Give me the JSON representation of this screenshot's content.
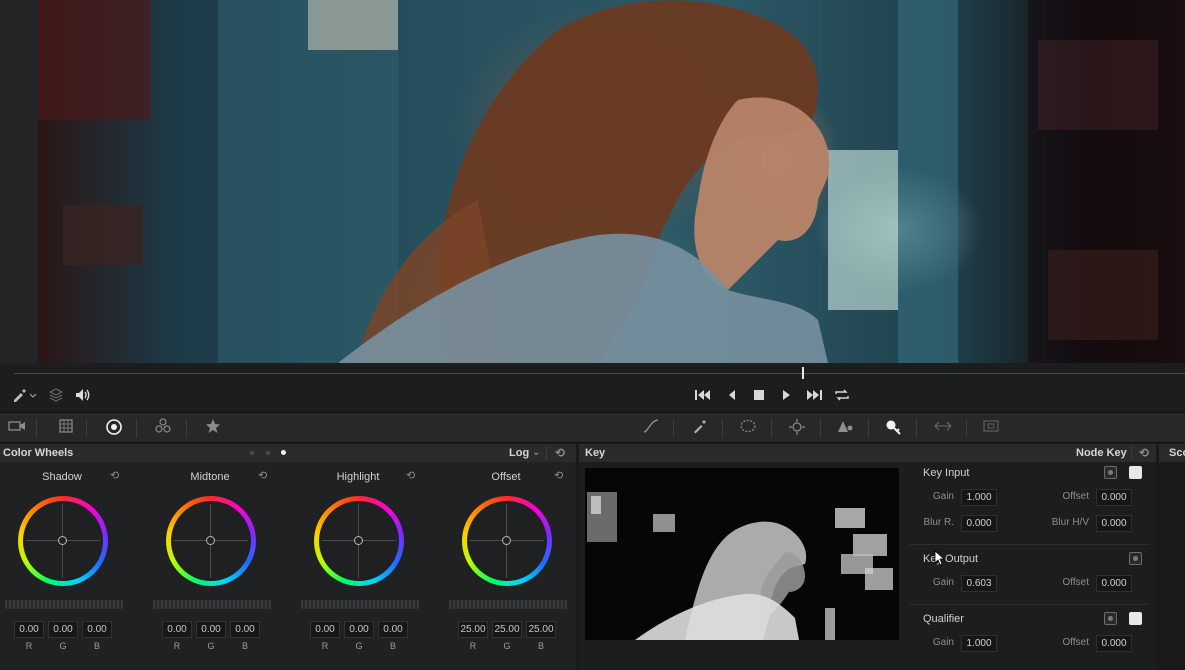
{
  "viewer": {
    "playhead_position": 0.674
  },
  "palette": {
    "active_tab": "color-wheels"
  },
  "color_wheels_panel": {
    "title": "Color Wheels",
    "mode": "Log",
    "page_dots": 3,
    "wheels": [
      {
        "name": "Shadow",
        "r": "0.00",
        "g": "0.00",
        "b": "0.00"
      },
      {
        "name": "Midtone",
        "r": "0.00",
        "g": "0.00",
        "b": "0.00"
      },
      {
        "name": "Highlight",
        "r": "0.00",
        "g": "0.00",
        "b": "0.00"
      },
      {
        "name": "Offset",
        "r": "25.00",
        "g": "25.00",
        "b": "25.00"
      }
    ],
    "channel_labels": {
      "r": "R",
      "g": "G",
      "b": "B"
    }
  },
  "key_panel": {
    "title": "Key",
    "mode": "Node Key",
    "key_input": {
      "title": "Key Input",
      "gain_label": "Gain",
      "gain": "1.000",
      "offset_label": "Offset",
      "offset": "0.000",
      "blur_r_label": "Blur R.",
      "blur_r": "0.000",
      "blur_hv_label": "Blur H/V",
      "blur_hv": "0.000"
    },
    "key_output": {
      "title": "Key Output",
      "gain_label": "Gain",
      "gain": "0.603",
      "offset_label": "Offset",
      "offset": "0.000"
    },
    "qualifier": {
      "title": "Qualifier",
      "gain_label": "Gain",
      "gain": "1.000",
      "offset_label": "Offset",
      "offset": "0.000"
    }
  },
  "scope_panel": {
    "title_partial": "Sco"
  },
  "colors": {
    "accent": "#ffffff",
    "panel_bg": "#202123"
  }
}
